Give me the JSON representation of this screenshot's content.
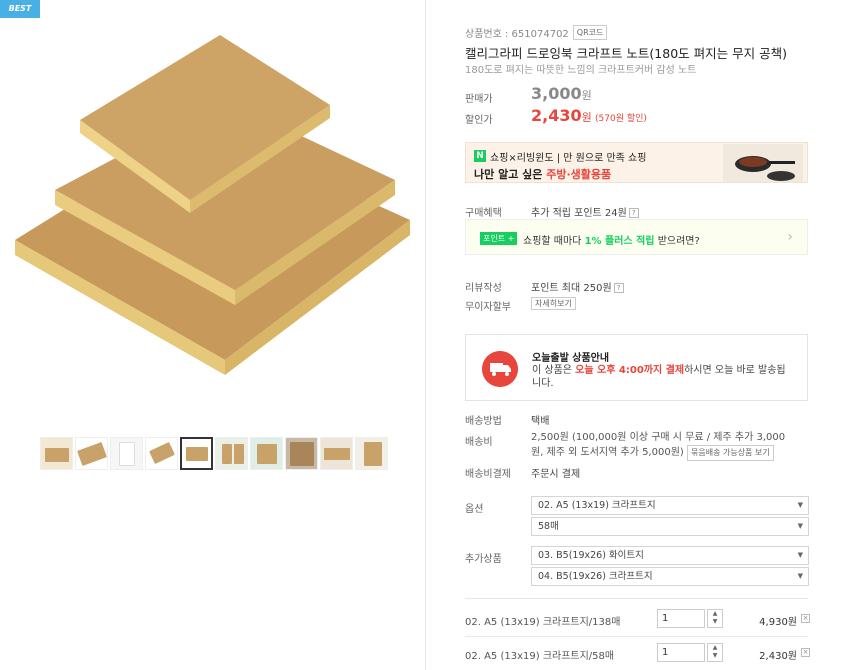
{
  "badge": "BEST",
  "thumbs_count": 10,
  "product": {
    "code_label": "상품번호 : 651074702",
    "qr_label": "QR코드",
    "title": "캘리그라피 드로잉북 크라프트 노트(180도 펴지는 무지 공책)",
    "subtitle": "180도로 펴지는 따뜻한 느낌의 크라프트커버 감성 노트"
  },
  "price": {
    "sale_label": "판매가",
    "sale_value": "3,000",
    "sale_unit": "원",
    "disc_label": "할인가",
    "disc_value": "2,430",
    "disc_unit": "원",
    "disc_note": "(570원 할인)"
  },
  "banner": {
    "logo": "N",
    "line1": "쇼핑×리빙윈도 | 만 원으로 만족 쇼핑",
    "line2_prefix": "나만 알고 싶은 ",
    "line2_highlight": "주방·생활용품"
  },
  "benefit": {
    "label": "구매혜택",
    "value": "추가 적립 포인트 24원",
    "point_tag": "포인트 +",
    "point_text_a": "쇼핑할 때마다 ",
    "point_text_b": "1% 플러스 적립",
    "point_text_c": " 받으려면?"
  },
  "review": {
    "label": "리뷰작성",
    "value": "포인트 최대 250원"
  },
  "installment": {
    "label": "무이자할부",
    "button": "자세히보기"
  },
  "today": {
    "title": "오늘출발 상품안내",
    "desc_a": "이 상품은 ",
    "desc_b": "오늘 오후 4:00까지 결제",
    "desc_c": "하시면 오늘 바로 발송됩니다."
  },
  "shipping": {
    "method_label": "배송방법",
    "method_value": "택배",
    "fee_label": "배송비",
    "fee_value": "2,500원 (100,000원 이상 구매 시 무료 / 제주 추가 3,000원, 제주 외 도서지역 추가 5,000원)",
    "fee_button": "묶음배송 가능상품 보기",
    "pay_label": "배송비결제",
    "pay_value": "주문시 결제"
  },
  "options": {
    "label": "옵션",
    "opt1": "02. A5 (13x19) 크라프트지",
    "opt2": "58매",
    "add_label": "추가상품",
    "add1": "03. B5(19x26) 화이트지",
    "add2": "04. B5(19x26) 크라프트지"
  },
  "selected": [
    {
      "name": "02. A5 (13x19) 크라프트지/138매",
      "qty": "1",
      "price": "4,930원"
    },
    {
      "name": "02. A5 (13x19) 크라프트지/58매",
      "qty": "1",
      "price": "2,430원"
    }
  ],
  "icons": {
    "remove": "×",
    "spin_up": "▲",
    "spin_down": "▼",
    "chevron": "›",
    "select_arrow": "▼",
    "question": "?"
  }
}
